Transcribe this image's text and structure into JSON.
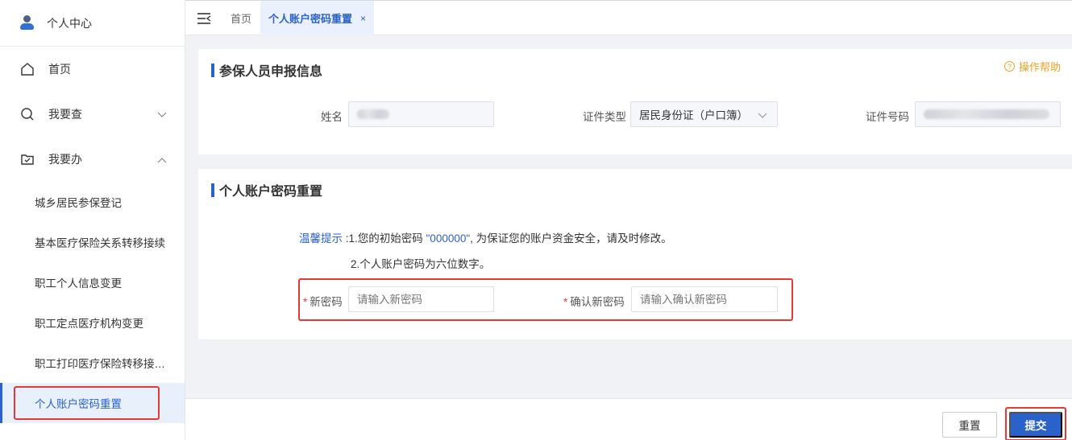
{
  "sidebar": {
    "user_label": "个人中心",
    "menu": {
      "home": "首页",
      "query": "我要查",
      "handle": "我要办"
    },
    "sub_items": [
      "城乡居民参保登记",
      "基本医疗保险关系转移接续",
      "职工个人信息变更",
      "职工定点医疗机构变更",
      "职工打印医疗保险转移接续凭证",
      "个人账户密码重置"
    ]
  },
  "tabs": {
    "home": "首页",
    "active": "个人账户密码重置",
    "close": "×"
  },
  "card1": {
    "title": "参保人员申报信息",
    "help": "操作帮助",
    "name_label": "姓名",
    "id_type_label": "证件类型",
    "id_type_value": "居民身份证（户口簿）",
    "id_no_label": "证件号码"
  },
  "card2": {
    "title": "个人账户密码重置",
    "hint_label": "温馨提示",
    "hint_line1_a": " :1.您的初始密码 ",
    "hint_line1_code": "\"000000\"",
    "hint_line1_b": ", 为保证您的账户资金安全，请及时修改。",
    "hint_line2": "2.个人账户密码为六位数字。",
    "required_mark": "*",
    "new_pwd_label": "新密码",
    "new_pwd_placeholder": "请输入新密码",
    "confirm_pwd_label": "确认新密码",
    "confirm_pwd_placeholder": "请输入确认新密码"
  },
  "footer": {
    "reset": "重置",
    "submit": "提交"
  },
  "colors": {
    "accent": "#2a62c9",
    "highlight_box": "#e53935",
    "help": "#f0a020"
  }
}
